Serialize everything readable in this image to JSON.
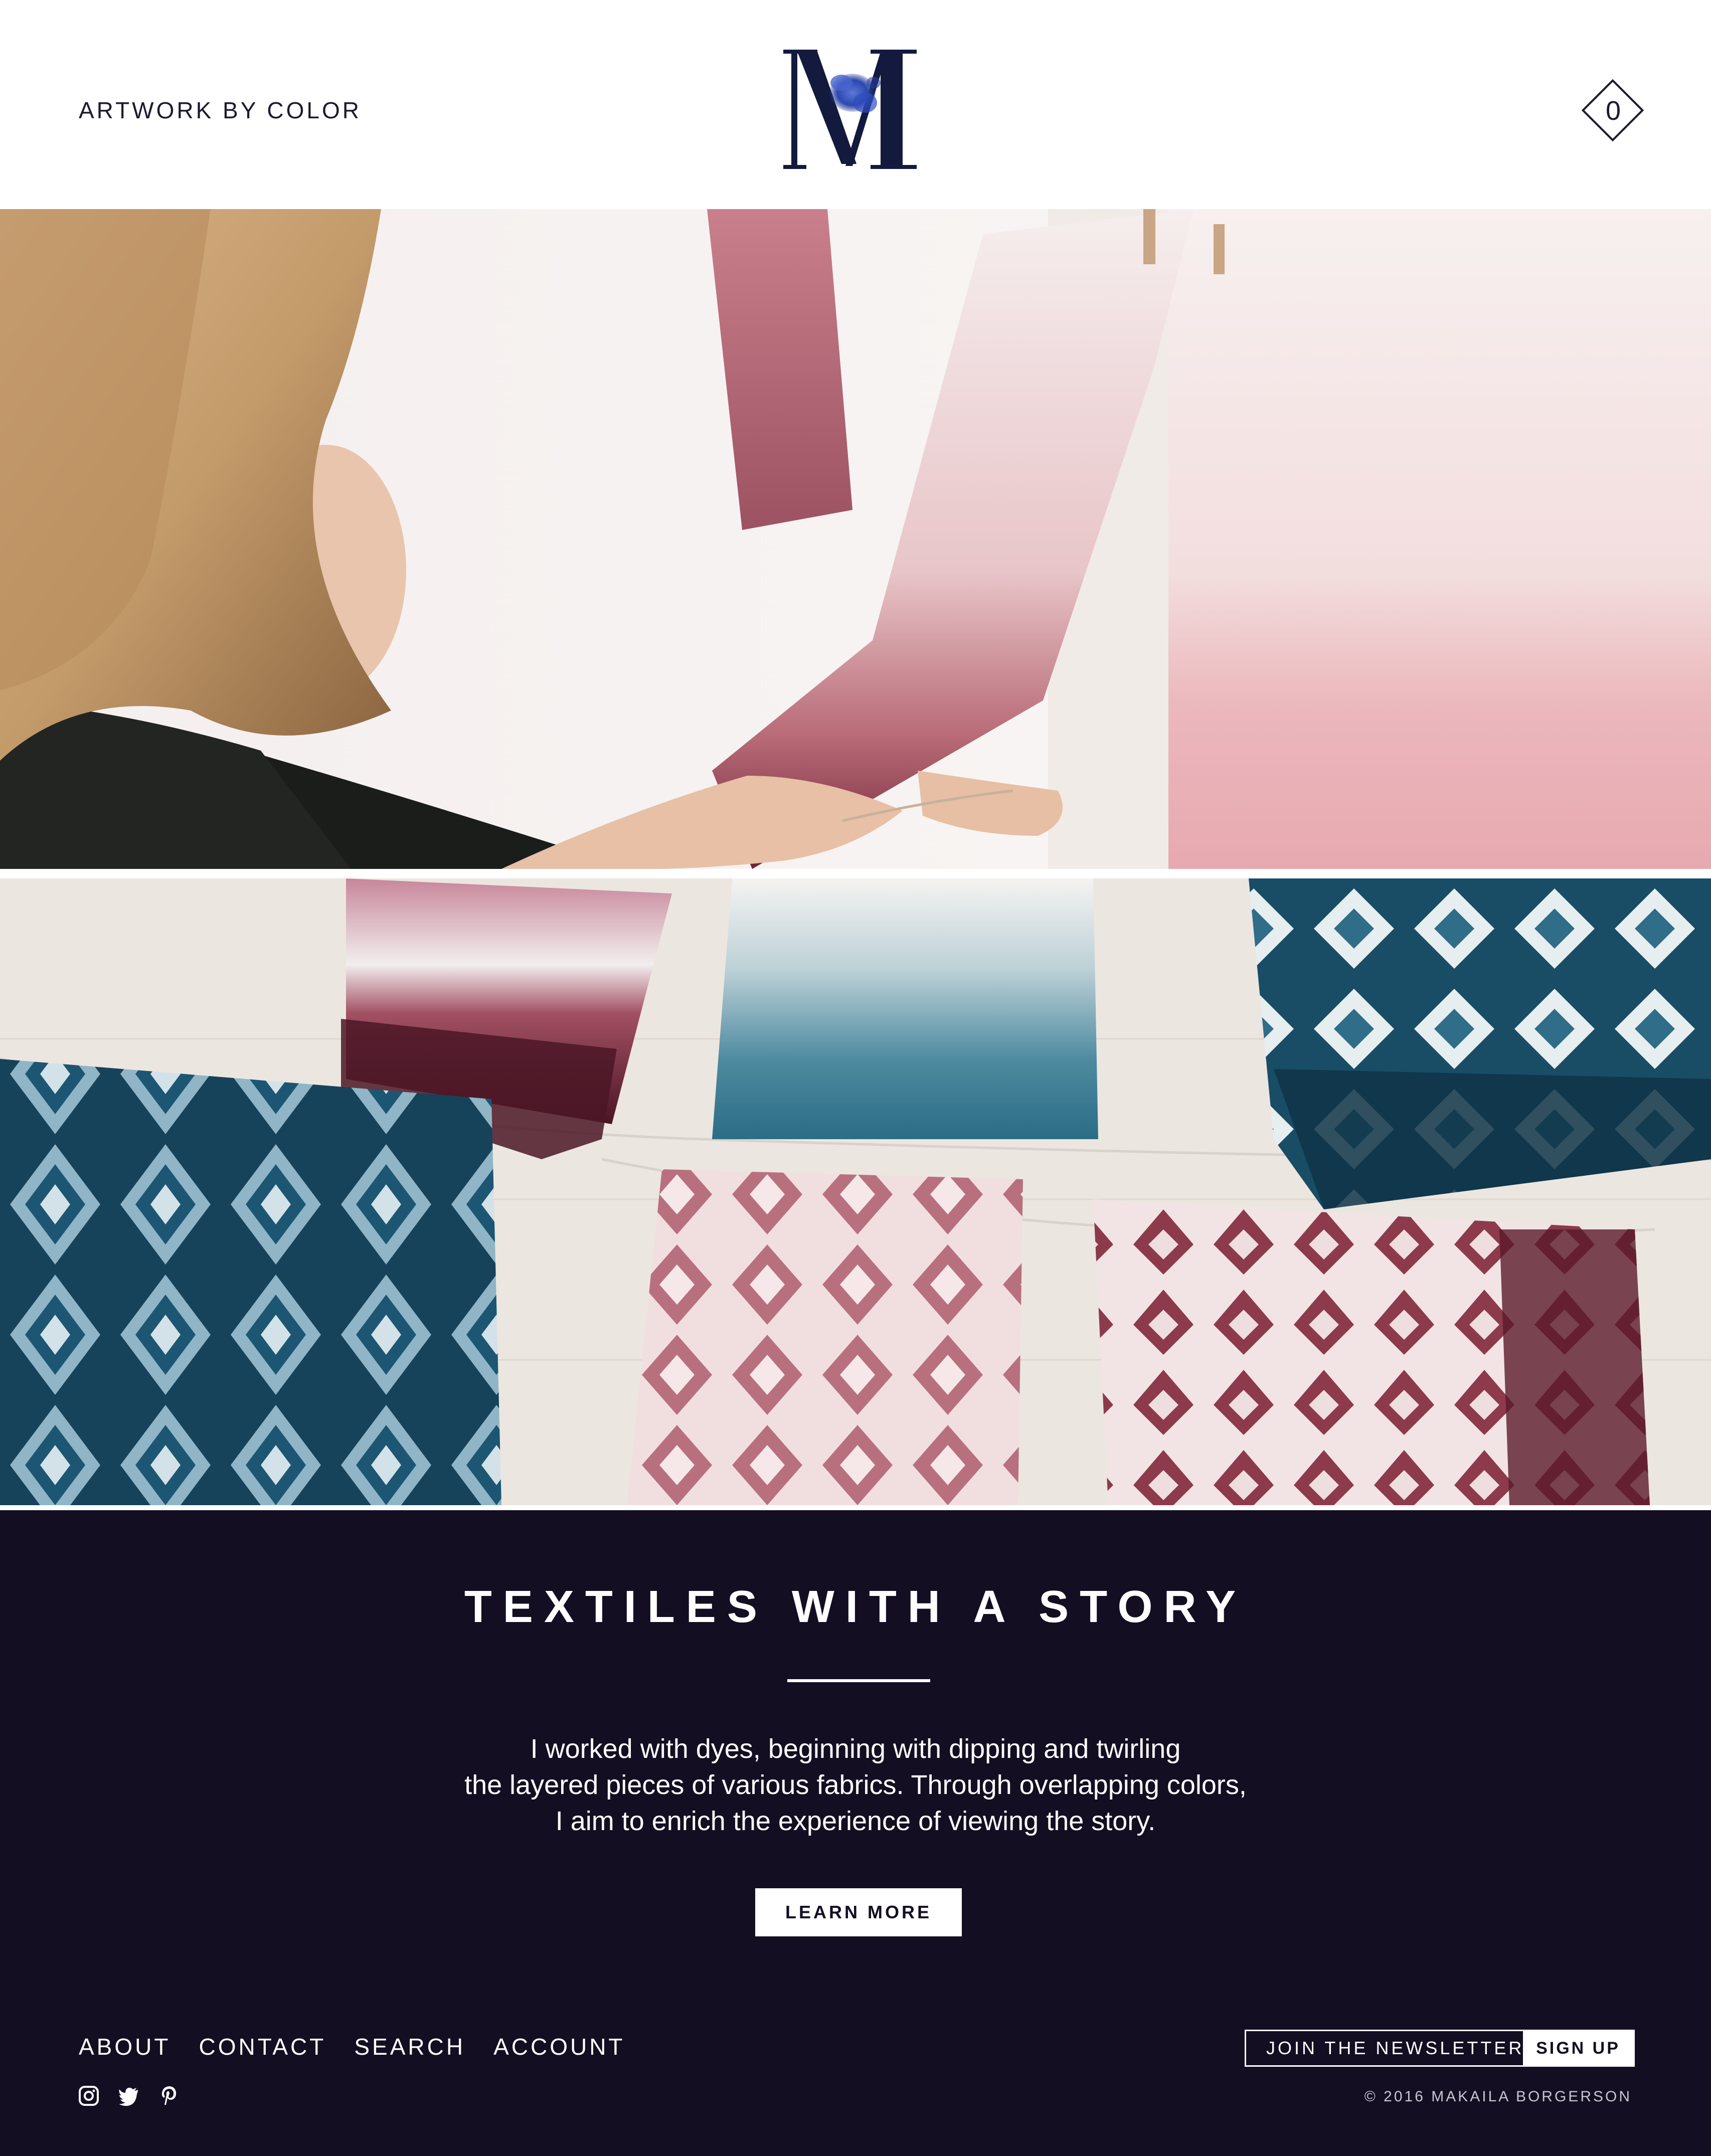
{
  "header": {
    "nav_link": "ARTWORK BY COLOR",
    "logo_letter": "M",
    "cart_count": "0"
  },
  "hero": {
    "photo_1": "woman-hanging-dyed-fabric",
    "photo_2": "dyed-textiles-on-line"
  },
  "story": {
    "title": "TEXTILES WITH A STORY",
    "lines": [
      "I worked with dyes, beginning with dipping and twirling",
      "the layered pieces of various fabrics. Through overlapping colors,",
      "I aim to enrich the experience of viewing the story."
    ],
    "button": "LEARN MORE"
  },
  "footer": {
    "nav": [
      "ABOUT",
      "CONTACT",
      "SEARCH",
      "ACCOUNT"
    ],
    "social_icons": [
      "instagram-icon",
      "twitter-icon",
      "pinterest-icon"
    ],
    "newsletter_placeholder": "JOIN THE NEWSLETTER",
    "signup_label": "SIGN UP",
    "copyright": "© 2016 MAKAILA BORGERSON"
  },
  "colors": {
    "brand_navy": "#1c1a2e",
    "panel_dark": "#130e22",
    "dye_indigo": "#1d5470",
    "dye_crimson": "#7e2a3c",
    "dye_pink": "#e9b3bb"
  }
}
